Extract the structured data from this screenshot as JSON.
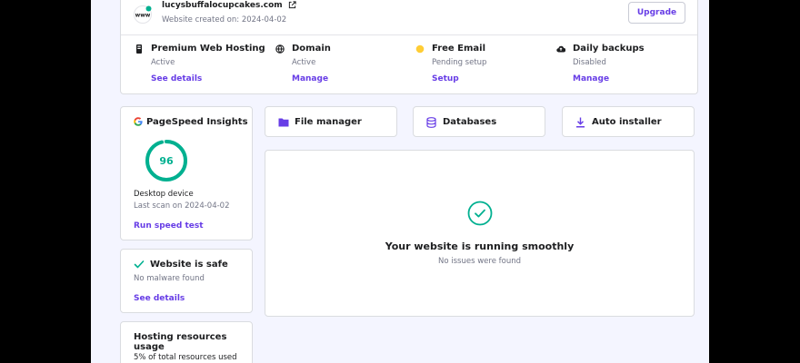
{
  "header": {
    "domain": "lucysbuffalocupcakes.com",
    "created": "Website created on: 2024-04-02",
    "upgrade_label": "Upgrade",
    "www_icon_text": "www"
  },
  "services": [
    {
      "title": "Premium Web Hosting",
      "status": "Active",
      "link": "See details",
      "icon": "hosting-icon"
    },
    {
      "title": "Domain",
      "status": "Active",
      "link": "Manage",
      "icon": "domain-icon"
    },
    {
      "title": "Free Email",
      "status": "Pending setup",
      "link": "Setup",
      "icon": "pending-dot-icon"
    },
    {
      "title": "Daily backups",
      "status": "Disabled",
      "link": "Manage",
      "icon": "cloud-backup-icon"
    }
  ],
  "pagespeed": {
    "title": "PageSpeed Insights",
    "score": "96",
    "score_value": 96,
    "device": "Desktop device",
    "last_scan": "Last scan on 2024-04-02",
    "link": "Run speed test"
  },
  "security": {
    "title": "Website is safe",
    "subtitle": "No malware found",
    "link": "See details"
  },
  "resources": {
    "title": "Hosting resources usage",
    "subtitle": "5% of total resources used"
  },
  "quick_actions": [
    {
      "label": "File manager",
      "icon": "folder-icon"
    },
    {
      "label": "Databases",
      "icon": "database-icon"
    },
    {
      "label": "Auto installer",
      "icon": "download-icon"
    }
  ],
  "status": {
    "title": "Your website is running smoothly",
    "subtitle": "No issues were found"
  },
  "colors": {
    "accent": "#673de6",
    "success": "#00b090",
    "warning": "#ffcd35",
    "background": "#f4f5ff"
  }
}
